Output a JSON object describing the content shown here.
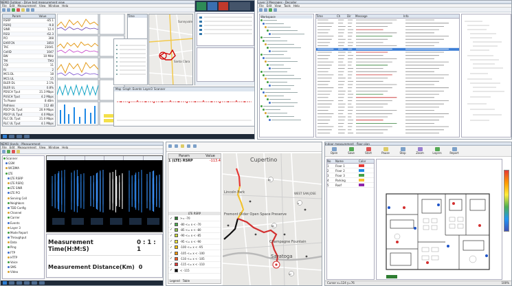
{
  "panel1": {
    "window_title": "NEMO Outdoor - Drive test measurement view",
    "menu": [
      "File",
      "Edit",
      "Measurement",
      "View",
      "Window",
      "Help"
    ],
    "params_header": [
      "Param",
      "Value"
    ],
    "params": [
      [
        "RSRP",
        "-85.1"
      ],
      [
        "RSRQ",
        "-9.8"
      ],
      [
        "SINR",
        "12.4"
      ],
      [
        "RSSI",
        "-62.3"
      ],
      [
        "PCI",
        "308"
      ],
      [
        "EARFCN",
        "1850"
      ],
      [
        "TAC",
        "23041"
      ],
      [
        "CellID",
        "1047"
      ],
      [
        "BW",
        "10 MHz"
      ],
      [
        "TM",
        "TM3"
      ],
      [
        "CQI",
        "11"
      ],
      [
        "RI",
        "2"
      ],
      [
        "MCS DL",
        "18"
      ],
      [
        "MCS UL",
        "15"
      ],
      [
        "BLER DL",
        "2.1%"
      ],
      [
        "BLER UL",
        "0.8%"
      ],
      [
        "PDSCH Tput",
        "21.3 Mbps"
      ],
      [
        "PUSCH Tput",
        "4.2 Mbps"
      ],
      [
        "Tx Power",
        "8 dBm"
      ],
      [
        "Pathloss",
        "112 dB"
      ],
      [
        "PDCP DL Tput",
        "20.9 Mbps"
      ],
      [
        "PDCP UL Tput",
        "4.0 Mbps"
      ],
      [
        "RLC DL Tput",
        "21.0 Mbps"
      ],
      [
        "RLC UL Tput",
        "4.1 Mbps"
      ]
    ],
    "map_labels": [
      "Sunnyvale",
      "Santa Clara",
      "Cupertino"
    ],
    "event_list_header": [
      "Time",
      "Event",
      "Value"
    ],
    "bottom_tabs": [
      "Map",
      "Graph",
      "Events",
      "Layer3",
      "Scanner"
    ]
  },
  "panel2": {
    "window_title": "Layer 3 Messages - Decoder",
    "menu": [
      "File",
      "Edit",
      "View",
      "Tools",
      "Help"
    ],
    "tree_title": "Workspace",
    "grid_headers": [
      "Time",
      "Ch",
      "Dir",
      "Message",
      "Info"
    ],
    "rows": 36
  },
  "panel3": {
    "window_title": "NEMO Handy - Measurement",
    "menu": [
      "File",
      "Edit",
      "Measurement",
      "View",
      "Window",
      "Help"
    ],
    "big_label_1": "Measurement Time(H:M:S)",
    "big_value_1": "0 : 1 : 1",
    "big_label_2": "Measurement Distance(Km)",
    "big_value_2": "0",
    "tree_items": [
      "Scanner",
      "GSM",
      "WCDMA",
      "LTE",
      "LTE RSRP",
      "LTE RSRQ",
      "LTE SINR",
      "LTE PCI",
      "Serving Cell",
      "Neighbors",
      "TDD Config",
      "Channel",
      "Carrier",
      "Events",
      "Layer 3",
      "Mode Report",
      "Throughput",
      "Data",
      "Ping",
      "FTP",
      "HTTP",
      "Voice",
      "SMS",
      "Video"
    ]
  },
  "panel4": {
    "header": [
      "Param",
      "Value"
    ],
    "row1": [
      "1 (LTE) RSRP",
      "-113.4"
    ],
    "legend_title": "LTE RSRP",
    "legend": [
      ">= -70 ",
      "-80 <= x < -70",
      "-85 <= x < -80",
      "-90 <= x < -85",
      "-95 <= x < -90",
      "-100 <= x < -95",
      "-105 <= x < -100",
      "-110 <= x < -105",
      "-115 <= x < -110",
      "< -115"
    ],
    "legend_colors": [
      "#2e7d32",
      "#4caf50",
      "#8bc34a",
      "#cddc39",
      "#ffeb3b",
      "#ffc107",
      "#ff9800",
      "#ff5722",
      "#e53935",
      "#000000"
    ],
    "map_labels": [
      "Cupertino",
      "Saratoga",
      "Champagne Fountain",
      "Lincoln Park",
      "Fremont Older Open Space Preserve",
      "WEST SAN JOSE"
    ],
    "road_numbers": [
      "85",
      "9",
      "85",
      "17"
    ],
    "bottom_tabs": [
      "Legend",
      "Table"
    ]
  },
  "panel5": {
    "window_title": "Indoor measurement - floor plan",
    "toolbar": [
      "Open",
      "Save",
      "Start",
      "Pause",
      "Stop",
      "Zoom",
      "Layers",
      "Report"
    ],
    "list_header": [
      "No",
      "Name",
      "Color"
    ],
    "list_rows": [
      [
        "1",
        "Floor 1",
        ""
      ],
      [
        "2",
        "Floor 2",
        ""
      ],
      [
        "3",
        "Floor 3",
        ""
      ],
      [
        "4",
        "Parking",
        ""
      ],
      [
        "5",
        "Roof",
        ""
      ]
    ],
    "status_left": "Cursor x=124 y=76",
    "status_right": "100%"
  }
}
